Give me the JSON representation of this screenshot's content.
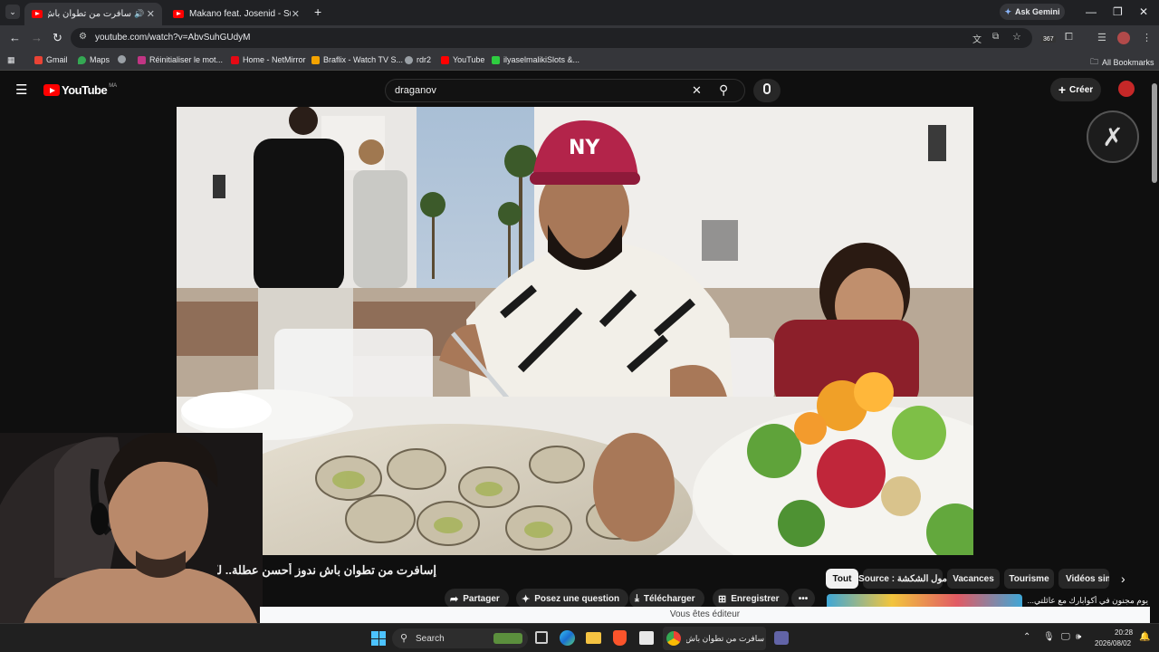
{
  "browser": {
    "tabs": [
      {
        "title": "سافرت من تطوان باش ندوز",
        "active": true
      },
      {
        "title": "Makano feat. Josenid - Su Nom",
        "active": false
      }
    ],
    "ask_gemini": "Ask Gemini",
    "url": "youtube.com/watch?v=AbvSuhGUdyM",
    "extension_badge": "367",
    "bookmarks": [
      {
        "label": "Gmail",
        "color": "#ea4335"
      },
      {
        "label": "Maps",
        "color": "#34a853"
      },
      {
        "label": "",
        "color": "#9aa0a6"
      },
      {
        "label": "Réinitialiser le mot...",
        "color": "#c13584"
      },
      {
        "label": "Home - NetMirror",
        "color": "#e50914"
      },
      {
        "label": "Braflix - Watch TV S...",
        "color": "#f4a300"
      },
      {
        "label": "rdr2",
        "color": "#9aa0a6"
      },
      {
        "label": "YouTube",
        "color": "#ff0000"
      },
      {
        "label": "ilyaselmalikiSlots &...",
        "color": "#2ecc40"
      }
    ],
    "all_bookmarks": "All Bookmarks"
  },
  "youtube": {
    "logo_text": "YouTube",
    "region": "MA",
    "search_value": "draganov",
    "create_label": "Créer",
    "video_title": "إسافرت من تطوان باش ندوز أحسن عطلة.. لكن خ 😱",
    "actions": [
      "Partager",
      "Posez une question",
      "Télécharger",
      "Enregistrer"
    ],
    "chips": [
      "Tout",
      "Source : مول الشكشة",
      "Vacances",
      "Tourisme",
      "Vidéos sim"
    ],
    "next_video_title": "يوم مجنون في أكوابارك مع عائلتي... 😱",
    "edit_banner": "Vous êtes éditeur"
  },
  "taskbar": {
    "search_label": "Search",
    "active_app_title": "سافرت من تطوان باش ندو",
    "time": "20:28",
    "date": "2026/08/02"
  }
}
